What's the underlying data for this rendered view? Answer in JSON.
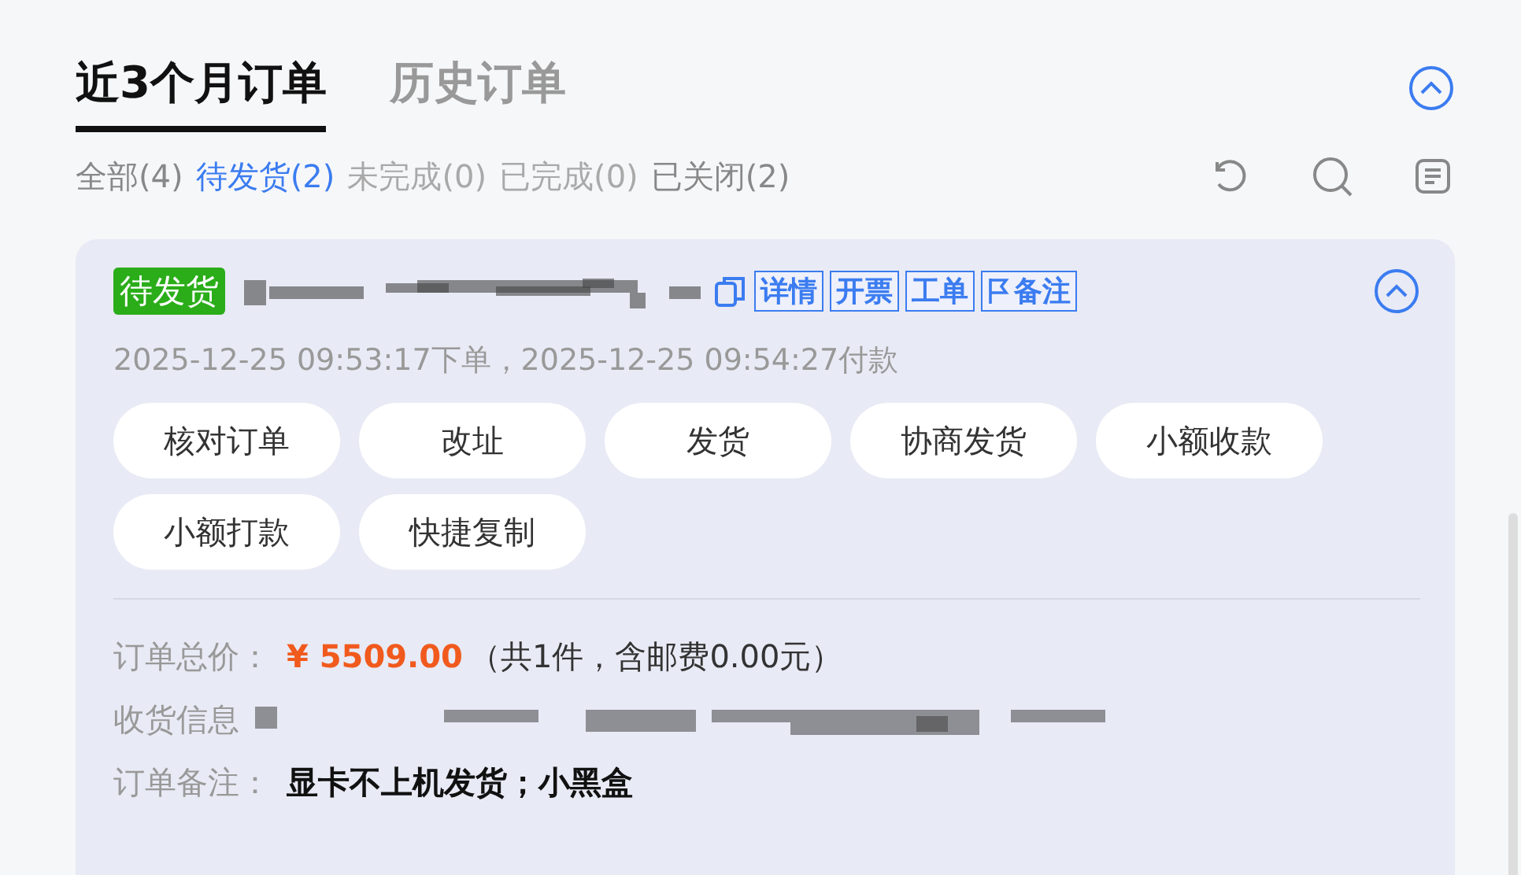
{
  "tabs": [
    {
      "label": "近3个月订单",
      "selected": true
    },
    {
      "label": "历史订单",
      "selected": false
    }
  ],
  "filters": [
    {
      "label": "全部(4)",
      "selected": false,
      "disabled": false
    },
    {
      "label": "待发货(2)",
      "selected": true,
      "disabled": false
    },
    {
      "label": "未完成(0)",
      "selected": false,
      "disabled": true
    },
    {
      "label": "已完成(0)",
      "selected": false,
      "disabled": true
    },
    {
      "label": "已关闭(2)",
      "selected": false,
      "disabled": false
    }
  ],
  "order": {
    "status": "待发货",
    "links": [
      {
        "label": "详情",
        "kind": "text"
      },
      {
        "label": "开票",
        "kind": "text"
      },
      {
        "label": "工单",
        "kind": "text"
      },
      {
        "label": "备注",
        "kind": "flag"
      }
    ],
    "times": "2025-12-25 09:53:17下单，2025-12-25 09:54:27付款",
    "actions": [
      "核对订单",
      "改址",
      "发货",
      "协商发货",
      "小额收款",
      "小额打款",
      "快捷复制"
    ],
    "fields": [
      {
        "label": "订单总价：",
        "kind": "price",
        "price": "¥ 5509.00",
        "value": "（共1件，含邮费0.00元）"
      },
      {
        "label": "收货信息",
        "kind": "redacted"
      },
      {
        "label": "订单备注：",
        "kind": "bold",
        "value": "显卡不上机发货；小黑盒"
      }
    ]
  }
}
